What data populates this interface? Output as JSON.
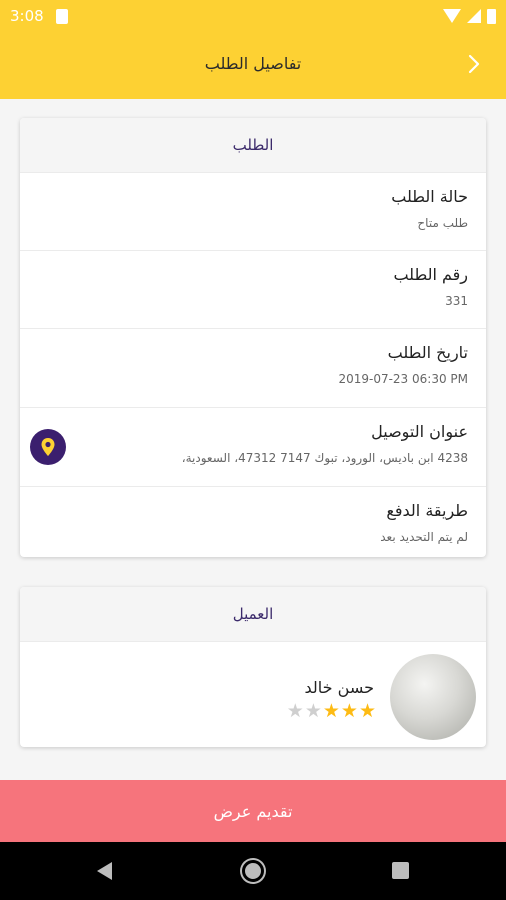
{
  "status_bar": {
    "time": "3:08"
  },
  "app_bar": {
    "title": "تفاصيل الطلب",
    "back_icon": "chevron-right-icon"
  },
  "order_card": {
    "header": "الطلب",
    "rows": [
      {
        "label": "حالة الطلب",
        "value": "طلب متاح"
      },
      {
        "label": "رقم الطلب",
        "value": "331"
      },
      {
        "label": "تاريخ الطلب",
        "value": "2019-07-23 06:30 PM"
      },
      {
        "label": "عنوان التوصيل",
        "value": "4238 ابن باديس، الورود، تبوك 7147 47312، السعودية،"
      },
      {
        "label": "طريقة الدفع",
        "value": "لم يتم التحديد بعد"
      }
    ]
  },
  "customer_card": {
    "header": "العميل",
    "name": "حسن خالد",
    "rating": 3,
    "max_rating": 5
  },
  "submit_label": "تقديم عرض",
  "colors": {
    "primary": "#fdd133",
    "accent": "#f6747c",
    "purple": "#3b1f6e",
    "star": "#fdbb14"
  }
}
